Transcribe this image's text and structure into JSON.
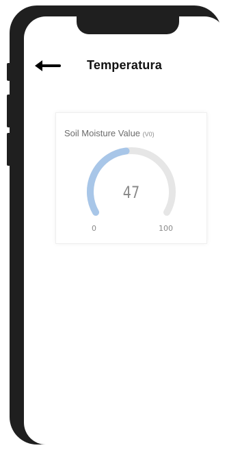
{
  "header": {
    "back_icon": "arrow-left-icon",
    "title": "Temperatura"
  },
  "widget": {
    "title": "Soil Moisture Value",
    "pin": "(V0)",
    "value": 47,
    "value_text": "47",
    "min": "0",
    "max": "100",
    "fill_color": "#a8c6e8",
    "track_color": "#e6e6e6"
  }
}
